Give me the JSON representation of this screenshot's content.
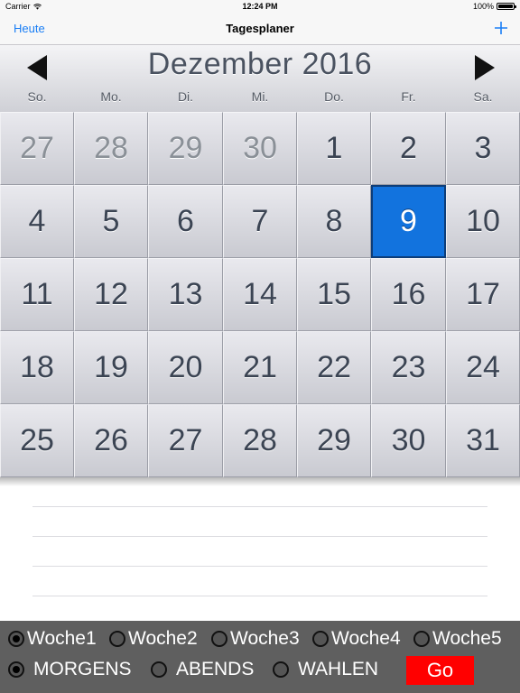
{
  "status_bar": {
    "carrier": "Carrier",
    "time": "12:24 PM",
    "battery": "100%"
  },
  "nav": {
    "left_button": "Heute",
    "title": "Tagesplaner",
    "add_icon": "plus-icon",
    "accent_color": "#1a7ef5"
  },
  "calendar": {
    "month_label": "Dezember 2016",
    "weekdays": [
      "So.",
      "Mo.",
      "Di.",
      "Mi.",
      "Do.",
      "Fr.",
      "Sa."
    ],
    "weeks": [
      [
        {
          "d": "27",
          "other": true
        },
        {
          "d": "28",
          "other": true
        },
        {
          "d": "29",
          "other": true
        },
        {
          "d": "30",
          "other": true
        },
        {
          "d": "1"
        },
        {
          "d": "2"
        },
        {
          "d": "3"
        }
      ],
      [
        {
          "d": "4"
        },
        {
          "d": "5"
        },
        {
          "d": "6"
        },
        {
          "d": "7"
        },
        {
          "d": "8"
        },
        {
          "d": "9",
          "selected": true
        },
        {
          "d": "10"
        }
      ],
      [
        {
          "d": "11"
        },
        {
          "d": "12"
        },
        {
          "d": "13"
        },
        {
          "d": "14"
        },
        {
          "d": "15"
        },
        {
          "d": "16"
        },
        {
          "d": "17"
        }
      ],
      [
        {
          "d": "18"
        },
        {
          "d": "19"
        },
        {
          "d": "20"
        },
        {
          "d": "21"
        },
        {
          "d": "22"
        },
        {
          "d": "23"
        },
        {
          "d": "24"
        }
      ],
      [
        {
          "d": "25"
        },
        {
          "d": "26"
        },
        {
          "d": "27"
        },
        {
          "d": "28"
        },
        {
          "d": "29"
        },
        {
          "d": "30"
        },
        {
          "d": "31"
        }
      ]
    ],
    "selected_color": "#1273de"
  },
  "week_options": [
    {
      "label": "Woche1",
      "selected": true
    },
    {
      "label": "Woche2",
      "selected": false
    },
    {
      "label": "Woche3",
      "selected": false
    },
    {
      "label": "Woche4",
      "selected": false
    },
    {
      "label": "Woche5",
      "selected": false
    }
  ],
  "time_options": [
    {
      "label": "MORGENS",
      "selected": true
    },
    {
      "label": "ABENDS",
      "selected": false
    },
    {
      "label": "WAHLEN",
      "selected": false
    }
  ],
  "go_button": {
    "label": "Go",
    "color": "#ff0000"
  }
}
